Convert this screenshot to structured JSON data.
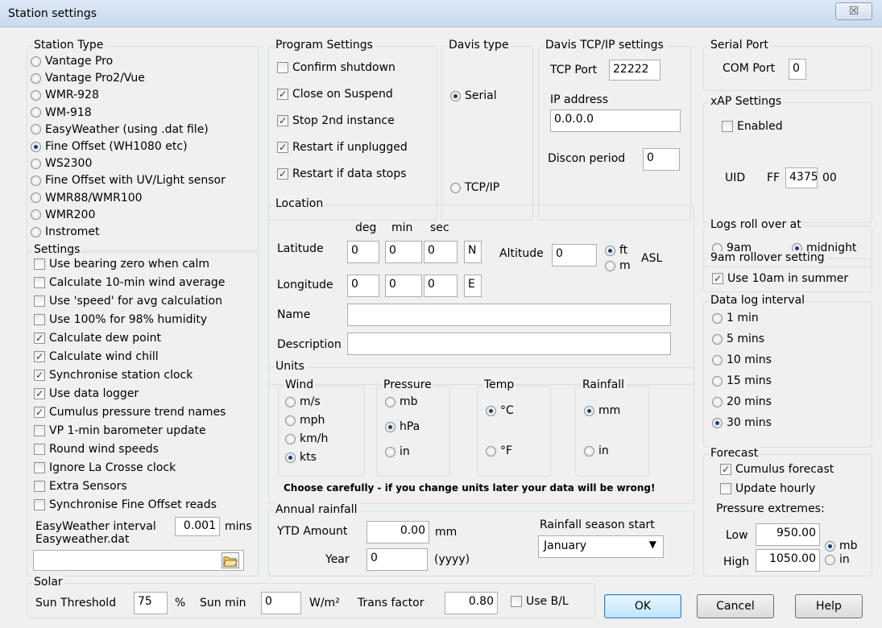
{
  "window": {
    "title": "Station settings",
    "close_glyph": "☒"
  },
  "station_type": {
    "legend": "Station Type",
    "options": [
      "Vantage Pro",
      "Vantage Pro2/Vue",
      "WMR-928",
      "WM-918",
      "EasyWeather (using .dat file)",
      "Fine Offset (WH1080 etc)",
      "WS2300",
      "Fine Offset with UV/Light sensor",
      "WMR88/WMR100",
      "WMR200",
      "Instromet"
    ],
    "selected": "Fine Offset (WH1080 etc)"
  },
  "settings": {
    "legend": "Settings",
    "checkboxes": [
      {
        "label": "Use bearing zero when calm",
        "checked": false
      },
      {
        "label": "Calculate 10-min wind average",
        "checked": false
      },
      {
        "label": "Use 'speed' for avg calculation",
        "checked": false
      },
      {
        "label": "Use 100% for 98% humidity",
        "checked": false
      },
      {
        "label": "Calculate dew point",
        "checked": true
      },
      {
        "label": "Calculate wind chill",
        "checked": true
      },
      {
        "label": "Synchronise station clock",
        "checked": true
      },
      {
        "label": "Use data logger",
        "checked": true
      },
      {
        "label": "Cumulus pressure trend names",
        "checked": true
      },
      {
        "label": "VP 1-min barometer update",
        "checked": false
      },
      {
        "label": "Round wind speeds",
        "checked": false
      },
      {
        "label": "Ignore La Crosse clock",
        "checked": false
      },
      {
        "label": "Extra Sensors",
        "checked": false
      },
      {
        "label": "Synchronise Fine Offset reads",
        "checked": false
      }
    ],
    "easyweather_interval_label": "EasyWeather interval",
    "easyweather_interval_value": "0.001",
    "easyweather_interval_unit": "mins",
    "easyweather_dat_label": "Easyweather.dat",
    "easyweather_dat_value": "",
    "folder_icon": "folder-open-icon"
  },
  "program_settings": {
    "legend": "Program Settings",
    "checkboxes": [
      {
        "label": "Confirm shutdown",
        "checked": false
      },
      {
        "label": "Close on Suspend",
        "checked": true
      },
      {
        "label": "Stop 2nd instance",
        "checked": true
      },
      {
        "label": "Restart if unplugged",
        "checked": true
      },
      {
        "label": "Restart if data stops",
        "checked": true
      }
    ]
  },
  "davis_type": {
    "legend": "Davis type",
    "options": [
      "Serial",
      "TCP/IP"
    ],
    "selected": "Serial"
  },
  "davis_tcp": {
    "legend": "Davis TCP/IP settings",
    "tcp_port_label": "TCP Port",
    "tcp_port_value": "22222",
    "ip_label": "IP address",
    "ip_value": "0.0.0.0",
    "discon_label": "Discon period",
    "discon_value": "0"
  },
  "serial_port": {
    "legend": "Serial Port",
    "com_label": "COM Port",
    "com_value": "0"
  },
  "xap": {
    "legend": "xAP Settings",
    "enabled_label": "Enabled",
    "enabled": false,
    "uid_label": "UID",
    "uid_prefix": "FF",
    "uid_value": "4375",
    "uid_suffix": "00"
  },
  "location": {
    "legend": "Location",
    "deg": "deg",
    "min": "min",
    "sec": "sec",
    "lat_label": "Latitude",
    "lat_deg": "0",
    "lat_min": "0",
    "lat_sec": "0",
    "lat_hemi": "N",
    "lon_label": "Longitude",
    "lon_deg": "0",
    "lon_min": "0",
    "lon_sec": "0",
    "lon_hemi": "E",
    "alt_label": "Altitude",
    "alt_value": "0",
    "alt_units": [
      "ft",
      "m"
    ],
    "alt_selected": "ft",
    "asl": "ASL",
    "name_label": "Name",
    "name_value": "",
    "desc_label": "Description",
    "desc_value": ""
  },
  "units": {
    "legend": "Units",
    "wind": {
      "legend": "Wind",
      "options": [
        "m/s",
        "mph",
        "km/h",
        "kts"
      ],
      "selected": "kts"
    },
    "pressure": {
      "legend": "Pressure",
      "options": [
        "mb",
        "hPa",
        "in"
      ],
      "selected": "hPa"
    },
    "temp": {
      "legend": "Temp",
      "options": [
        "°C",
        "°F"
      ],
      "selected": "°C"
    },
    "rainfall": {
      "legend": "Rainfall",
      "options": [
        "mm",
        "in"
      ],
      "selected": "mm"
    },
    "warning": "Choose carefully - if you change units later your data will be wrong!"
  },
  "annual_rainfall": {
    "legend": "Annual rainfall",
    "ytd_label": "YTD Amount",
    "ytd_value": "0.00",
    "ytd_unit": "mm",
    "year_label": "Year",
    "year_value": "0",
    "year_hint": "(yyyy)",
    "season_label": "Rainfall season start",
    "season_value": "January"
  },
  "logs_rollover": {
    "legend": "Logs roll over at",
    "options": [
      "9am",
      "midnight"
    ],
    "selected": "midnight"
  },
  "rollover_9am": {
    "legend": "9am rollover setting",
    "label": "Use 10am in summer",
    "checked": true
  },
  "data_log": {
    "legend": "Data log interval",
    "options": [
      "1 min",
      "5 mins",
      "10 mins",
      "15 mins",
      "20 mins",
      "30 mins"
    ],
    "selected": "30 mins"
  },
  "forecast": {
    "legend": "Forecast",
    "cumulus_label": "Cumulus forecast",
    "cumulus_checked": true,
    "hourly_label": "Update hourly",
    "hourly_checked": false,
    "extremes_label": "Pressure extremes:",
    "low_label": "Low",
    "low_value": "950.00",
    "high_label": "High",
    "high_value": "1050.00",
    "units": [
      "mb",
      "in"
    ],
    "unit_selected": "mb"
  },
  "solar": {
    "legend": "Solar",
    "threshold_label": "Sun Threshold",
    "threshold_value": "75",
    "threshold_unit": "%",
    "sunmin_label": "Sun min",
    "sunmin_value": "0",
    "sunmin_unit": "W/m²",
    "trans_label": "Trans factor",
    "trans_value": "0.80",
    "useBL_label": "Use B/L",
    "useBL_checked": false
  },
  "buttons": {
    "ok": "OK",
    "cancel": "Cancel",
    "help": "Help"
  }
}
